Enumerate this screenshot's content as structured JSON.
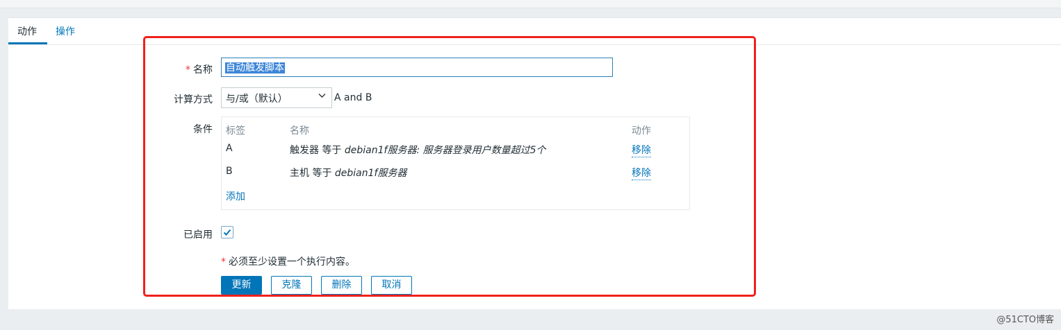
{
  "tabs": [
    {
      "label": "动作"
    },
    {
      "label": "操作"
    }
  ],
  "form": {
    "name": {
      "required_mark": "*",
      "label": "名称",
      "value": "自动触发脚本"
    },
    "calculation": {
      "label": "计算方式",
      "selected": "与/或（默认）",
      "formula": "A and B"
    },
    "conditions": {
      "label": "条件",
      "headers": {
        "tag": "标签",
        "name": "名称",
        "action": "动作"
      },
      "rows": [
        {
          "tag": "A",
          "prefix": "触发器 等于 ",
          "value": "debian1f服务器: 服务器登录用户数量超过5个",
          "action": "移除"
        },
        {
          "tag": "B",
          "prefix": "主机 等于 ",
          "value": "debian1f服务器",
          "action": "移除"
        }
      ],
      "add_label": "添加"
    },
    "enabled": {
      "label": "已启用",
      "checked": true
    },
    "note": {
      "required_mark": "*",
      "text": "必须至少设置一个执行内容。"
    }
  },
  "buttons": {
    "update": "更新",
    "clone": "克隆",
    "delete": "删除",
    "cancel": "取消"
  },
  "watermark": "@51CTO博客",
  "colors": {
    "accent": "#0275b8",
    "required": "#e33734",
    "highlight_border": "#f0201a"
  }
}
